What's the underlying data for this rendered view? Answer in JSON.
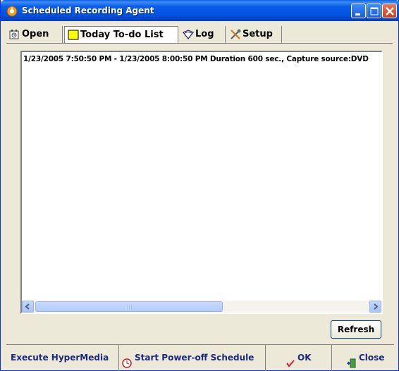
{
  "window": {
    "title": "Scheduled Recording Agent"
  },
  "tabs": [
    {
      "label": "Open",
      "icon": "clock-icon"
    },
    {
      "label": "Today To-do List",
      "icon": "note-icon",
      "active": true
    },
    {
      "label": "Log",
      "icon": "book-icon"
    },
    {
      "label": "Setup",
      "icon": "tools-icon"
    }
  ],
  "todo_list": {
    "items": [
      "1/23/2005 7:50:50 PM - 1/23/2005 8:00:50 PM Duration 600 sec., Capture source:DVD"
    ]
  },
  "buttons": {
    "refresh": "Refresh",
    "execute": "Execute HyperMedia",
    "power_off": "Start Power-off Schedule",
    "ok": "OK",
    "close": "Close"
  },
  "colors": {
    "titlebar": "#0054e3",
    "window_bg": "#ece9d8",
    "button_text": "#1a2a80",
    "tab_note_yellow": "#ffff00"
  }
}
